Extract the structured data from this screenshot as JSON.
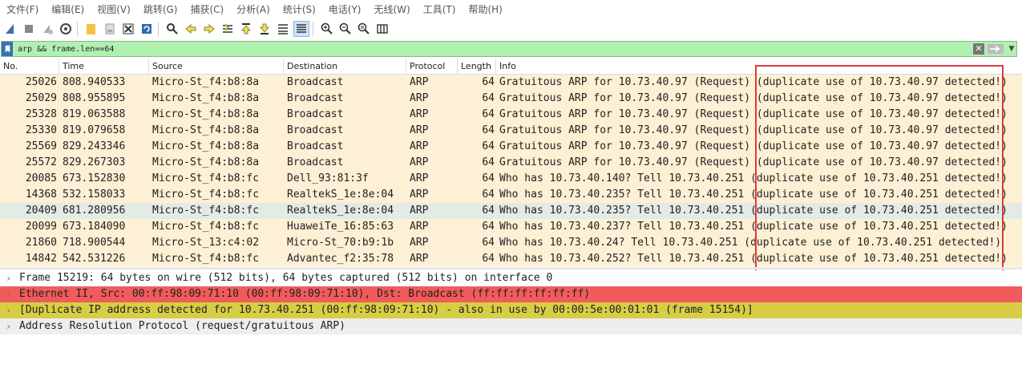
{
  "menu": [
    "文件(F)",
    "编辑(E)",
    "视图(V)",
    "跳转(G)",
    "捕获(C)",
    "分析(A)",
    "统计(S)",
    "电话(Y)",
    "无线(W)",
    "工具(T)",
    "帮助(H)"
  ],
  "toolbar_icons": [
    "shark-fin-icon",
    "stop-icon",
    "restart-icon",
    "options-icon",
    "open-folder-icon",
    "file-icon",
    "close-file-icon",
    "reload-icon",
    "find-icon",
    "go-back-icon",
    "go-forward-icon",
    "go-to-packet-icon",
    "go-first-icon",
    "go-last-icon",
    "auto-scroll-icon",
    "colorize-icon",
    "zoom-in-icon",
    "zoom-out-icon",
    "zoom-reset-icon",
    "resize-columns-icon"
  ],
  "filter": {
    "value": "arp && frame.len==64"
  },
  "columns": [
    "No.",
    "Time",
    "Source",
    "Destination",
    "Protocol",
    "Length",
    "Info"
  ],
  "packets": [
    {
      "no": "25026",
      "time": "808.940533",
      "src": "Micro-St_f4:b8:8a",
      "dst": "Broadcast",
      "proto": "ARP",
      "len": "64",
      "info": "Gratuitous ARP for 10.73.40.97 (Request) (duplicate use of 10.73.40.97 detected!)"
    },
    {
      "no": "25029",
      "time": "808.955895",
      "src": "Micro-St_f4:b8:8a",
      "dst": "Broadcast",
      "proto": "ARP",
      "len": "64",
      "info": "Gratuitous ARP for 10.73.40.97 (Request) (duplicate use of 10.73.40.97 detected!)"
    },
    {
      "no": "25328",
      "time": "819.063588",
      "src": "Micro-St_f4:b8:8a",
      "dst": "Broadcast",
      "proto": "ARP",
      "len": "64",
      "info": "Gratuitous ARP for 10.73.40.97 (Request) (duplicate use of 10.73.40.97 detected!)"
    },
    {
      "no": "25330",
      "time": "819.079658",
      "src": "Micro-St_f4:b8:8a",
      "dst": "Broadcast",
      "proto": "ARP",
      "len": "64",
      "info": "Gratuitous ARP for 10.73.40.97 (Request) (duplicate use of 10.73.40.97 detected!)"
    },
    {
      "no": "25569",
      "time": "829.243346",
      "src": "Micro-St_f4:b8:8a",
      "dst": "Broadcast",
      "proto": "ARP",
      "len": "64",
      "info": "Gratuitous ARP for 10.73.40.97 (Request) (duplicate use of 10.73.40.97 detected!)"
    },
    {
      "no": "25572",
      "time": "829.267303",
      "src": "Micro-St_f4:b8:8a",
      "dst": "Broadcast",
      "proto": "ARP",
      "len": "64",
      "info": "Gratuitous ARP for 10.73.40.97 (Request) (duplicate use of 10.73.40.97 detected!)"
    },
    {
      "no": "20085",
      "time": "673.152830",
      "src": "Micro-St_f4:b8:fc",
      "dst": "Dell_93:81:3f",
      "proto": "ARP",
      "len": "64",
      "info": "Who has 10.73.40.140? Tell 10.73.40.251 (duplicate use of 10.73.40.251 detected!)"
    },
    {
      "no": "14368",
      "time": "532.158033",
      "src": "Micro-St_f4:b8:fc",
      "dst": "RealtekS_1e:8e:04",
      "proto": "ARP",
      "len": "64",
      "info": "Who has 10.73.40.235? Tell 10.73.40.251 (duplicate use of 10.73.40.251 detected!)"
    },
    {
      "no": "20409",
      "time": "681.280956",
      "src": "Micro-St_f4:b8:fc",
      "dst": "RealtekS_1e:8e:04",
      "proto": "ARP",
      "len": "64",
      "info": "Who has 10.73.40.235? Tell 10.73.40.251 (duplicate use of 10.73.40.251 detected!)",
      "selected": true
    },
    {
      "no": "20099",
      "time": "673.184090",
      "src": "Micro-St_f4:b8:fc",
      "dst": "HuaweiTe_16:85:63",
      "proto": "ARP",
      "len": "64",
      "info": "Who has 10.73.40.237? Tell 10.73.40.251 (duplicate use of 10.73.40.251 detected!)"
    },
    {
      "no": "21860",
      "time": "718.900544",
      "src": "Micro-St_13:c4:02",
      "dst": "Micro-St_70:b9:1b",
      "proto": "ARP",
      "len": "64",
      "info": "Who has 10.73.40.24? Tell 10.73.40.251 (duplicate use of 10.73.40.251 detected!)"
    },
    {
      "no": "14842",
      "time": "542.531226",
      "src": "Micro-St_f4:b8:fc",
      "dst": "Advantec_f2:35:78",
      "proto": "ARP",
      "len": "64",
      "info": "Who has 10.73.40.252? Tell 10.73.40.251 (duplicate use of 10.73.40.251 detected!)"
    }
  ],
  "details": [
    {
      "text": "Frame 15219: 64 bytes on wire (512 bits), 64 bytes captured (512 bits) on interface 0",
      "style": "plain"
    },
    {
      "text": "Ethernet II, Src: 00:ff:98:09:71:10 (00:ff:98:09:71:10), Dst: Broadcast (ff:ff:ff:ff:ff:ff)",
      "style": "eth"
    },
    {
      "text": "[Duplicate IP address detected for 10.73.40.251 (00:ff:98:09:71:10) - also in use by 00:00:5e:00:01:01 (frame 15154)]",
      "style": "warn"
    },
    {
      "text": "Address Resolution Protocol (request/gratuitous ARP)",
      "style": "arp"
    }
  ],
  "colors": {
    "row_bg": "#fdf0d5",
    "selected_bg": "#e4ebe4",
    "eth_bg": "#f25b5b",
    "warn_bg": "#d7ce45",
    "filter_bg": "#b0f0b0",
    "highlight_box": "#dc3c3c"
  }
}
